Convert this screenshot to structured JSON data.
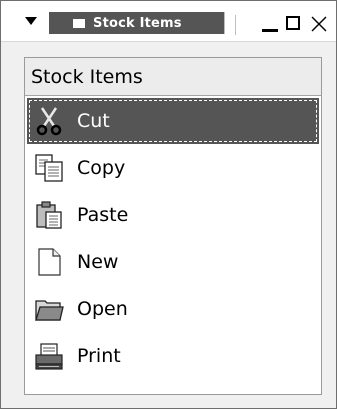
{
  "window": {
    "title": "Stock Items"
  },
  "list": {
    "header": "Stock Items",
    "items": [
      {
        "label": "Cut",
        "icon": "scissors-icon",
        "selected": true
      },
      {
        "label": "Copy",
        "icon": "copy-icon",
        "selected": false
      },
      {
        "label": "Paste",
        "icon": "paste-icon",
        "selected": false
      },
      {
        "label": "New",
        "icon": "new-document-icon",
        "selected": false
      },
      {
        "label": "Open",
        "icon": "folder-icon",
        "selected": false
      },
      {
        "label": "Print",
        "icon": "printer-icon",
        "selected": false
      }
    ]
  },
  "colors": {
    "selection": "#555555",
    "titlebar_tab": "#555555"
  }
}
